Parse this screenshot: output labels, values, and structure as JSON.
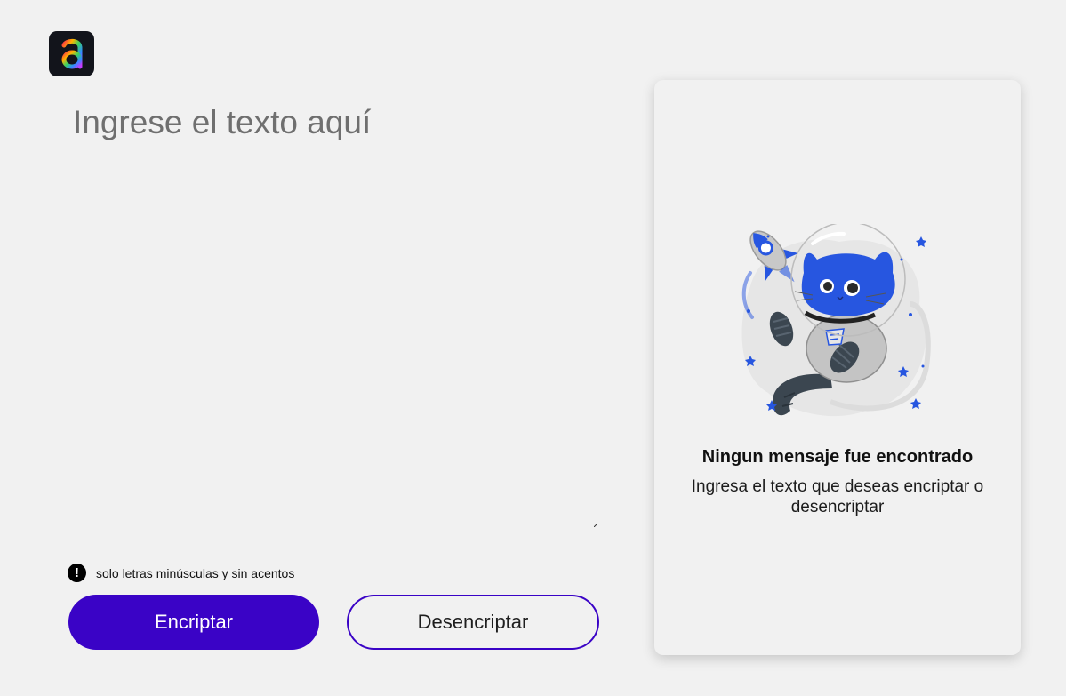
{
  "logo": {
    "letter": "a",
    "icon": "alura-logo-icon"
  },
  "input": {
    "placeholder": "Ingrese el texto aquí",
    "value": ""
  },
  "hint": {
    "icon": "exclamation-icon",
    "symbol": "!",
    "text": "solo letras minúsculas y sin acentos"
  },
  "buttons": {
    "encrypt_label": "Encriptar",
    "decrypt_label": "Desencriptar"
  },
  "output": {
    "illustration": "astronaut-cat-illustration",
    "title": "Ningun mensaje fue encontrado",
    "description": "Ingresa el texto que deseas encriptar o desencriptar"
  },
  "colors": {
    "background": "#f1f1f1",
    "accent": "#3a03c6",
    "logo_bg": "#12141b",
    "cat_blue": "#2756e0"
  }
}
